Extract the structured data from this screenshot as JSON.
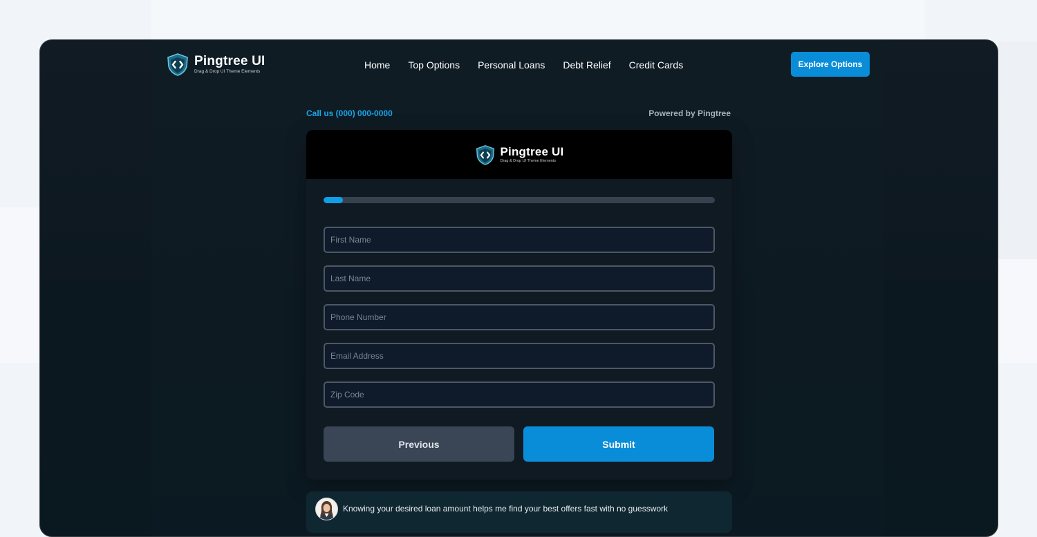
{
  "nav": {
    "logo": {
      "name": "Pingtree UI",
      "tagline": "Drag & Drop UI Theme Elements"
    },
    "links": [
      "Home",
      "Top Options",
      "Personal Loans",
      "Debt Relief",
      "Credit Cards"
    ],
    "cta_label": "Explore Options"
  },
  "topbar": {
    "call_text": "Call us (000) 000-0000",
    "powered_text": "Powered by Pingtree"
  },
  "card": {
    "logo": {
      "name": "Pingtree UI",
      "tagline": "Drag & Drop UI Theme Elements"
    },
    "progress_percent": 5,
    "fields": [
      {
        "placeholder": "First Name",
        "value": ""
      },
      {
        "placeholder": "Last Name",
        "value": ""
      },
      {
        "placeholder": "Phone Number",
        "value": ""
      },
      {
        "placeholder": "Email Address",
        "value": ""
      },
      {
        "placeholder": "Zip Code",
        "value": ""
      }
    ],
    "previous_label": "Previous",
    "submit_label": "Submit"
  },
  "hint": {
    "text": "Knowing your desired loan amount helps me find your best offers fast with no guesswork"
  },
  "colors": {
    "accent": "#0a8dd8",
    "link_accent": "#1ba5e6",
    "background": "#0c1820",
    "card": "#0f1a23"
  },
  "icons": {
    "logo": "code-shield-icon",
    "avatar": "advisor-avatar"
  }
}
